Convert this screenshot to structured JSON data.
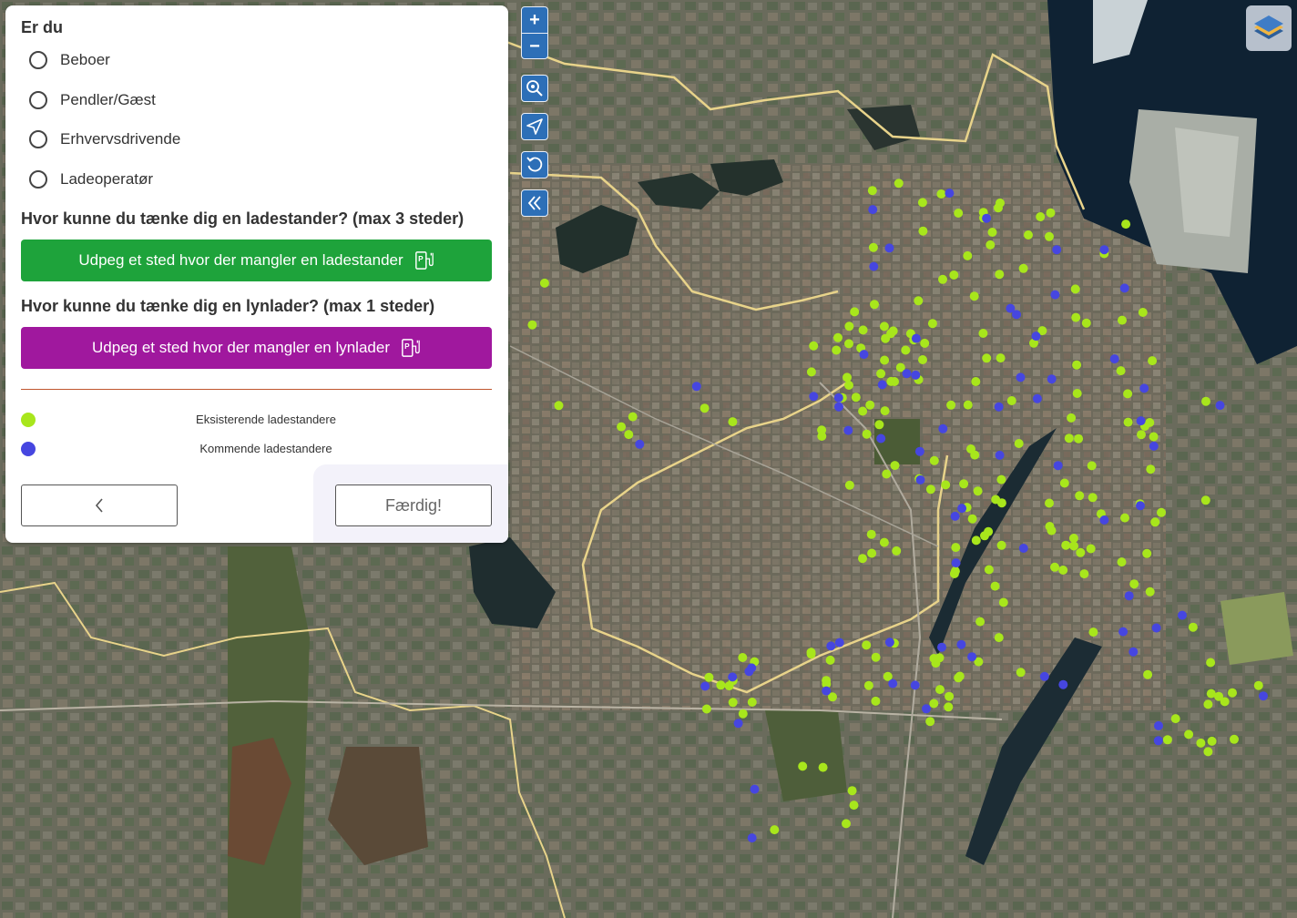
{
  "form": {
    "question_role": "Er du",
    "role_options": [
      "Beboer",
      "Pendler/Gæst",
      "Erhvervsdrivende",
      "Ladeoperatør"
    ],
    "question_charger": "Hvor kunne du tænke dig en ladestander? (max 3 steder)",
    "charger_button_label": "Udpeg et sted hvor der mangler en ladestander",
    "question_fast_charger": "Hvor kunne du tænke dig en lynlader? (max 1 steder)",
    "fast_charger_button_label": "Udpeg et sted hvor der mangler en lynlader",
    "legend": [
      {
        "label": "Eksisterende ladestandere",
        "color": "#a8e61c"
      },
      {
        "label": "Kommende ladestandere",
        "color": "#4646e0"
      }
    ],
    "back_icon": "chevron-left-icon",
    "done_label": "Færdig!"
  },
  "map_controls": {
    "zoom_in_icon": "plus-icon",
    "zoom_out_icon": "minus-icon",
    "search_icon": "zoom-search-icon",
    "locate_icon": "navigate-arrow-icon",
    "reset_icon": "rotate-ccw-icon",
    "collapse_icon": "double-chevron-left-icon",
    "layers_icon": "layers-icon"
  },
  "colors": {
    "green_button": "#1ea33b",
    "purple_button": "#a0189e",
    "control_blue": "#2d6fb7",
    "divider": "#c0562f",
    "existing_marker": "#a8e61c",
    "upcoming_marker": "#4646e0",
    "boundary_line": "#e8d38a"
  }
}
